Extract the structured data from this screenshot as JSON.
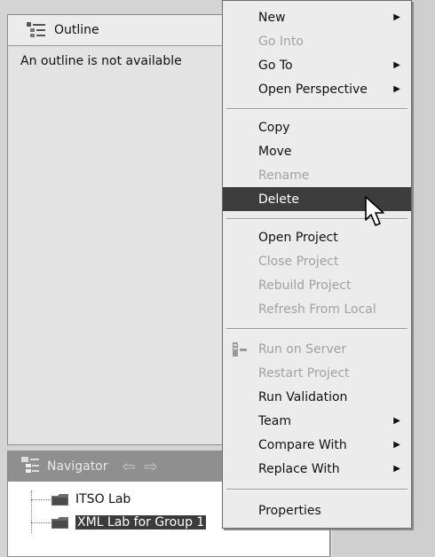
{
  "outline": {
    "title": "Outline",
    "message": "An outline is not available"
  },
  "navigator": {
    "title": "Navigator",
    "back_arrow": "⇦",
    "forward_arrow": "⇨",
    "items": [
      {
        "label": "ITSO Lab"
      },
      {
        "label": "XML Lab for Group 1",
        "selected": true
      }
    ]
  },
  "context_menu": {
    "items": [
      {
        "label": "New",
        "submenu": true
      },
      {
        "label": "Go Into",
        "disabled": true
      },
      {
        "label": "Go To",
        "submenu": true
      },
      {
        "label": "Open Perspective",
        "submenu": true
      },
      {
        "label": "Copy"
      },
      {
        "label": "Move"
      },
      {
        "label": "Rename",
        "disabled": true
      },
      {
        "label": "Delete",
        "highlighted": true
      },
      {
        "label": "Open Project"
      },
      {
        "label": "Close Project",
        "disabled": true
      },
      {
        "label": "Rebuild Project",
        "disabled": true
      },
      {
        "label": "Refresh From Local",
        "disabled": true
      },
      {
        "label": "Run on Server",
        "disabled": true,
        "icon": "run-on-server-icon"
      },
      {
        "label": "Restart Project",
        "disabled": true
      },
      {
        "label": "Run Validation"
      },
      {
        "label": "Team",
        "submenu": true
      },
      {
        "label": "Compare With",
        "submenu": true
      },
      {
        "label": "Replace With",
        "submenu": true
      },
      {
        "label": "Properties"
      }
    ]
  },
  "icons": {
    "outline": "outline-icon",
    "navigator": "navigator-icon",
    "folder": "project-folder-icon",
    "submenu": "submenu-arrow-icon",
    "cursor": "mouse-pointer-icon"
  }
}
